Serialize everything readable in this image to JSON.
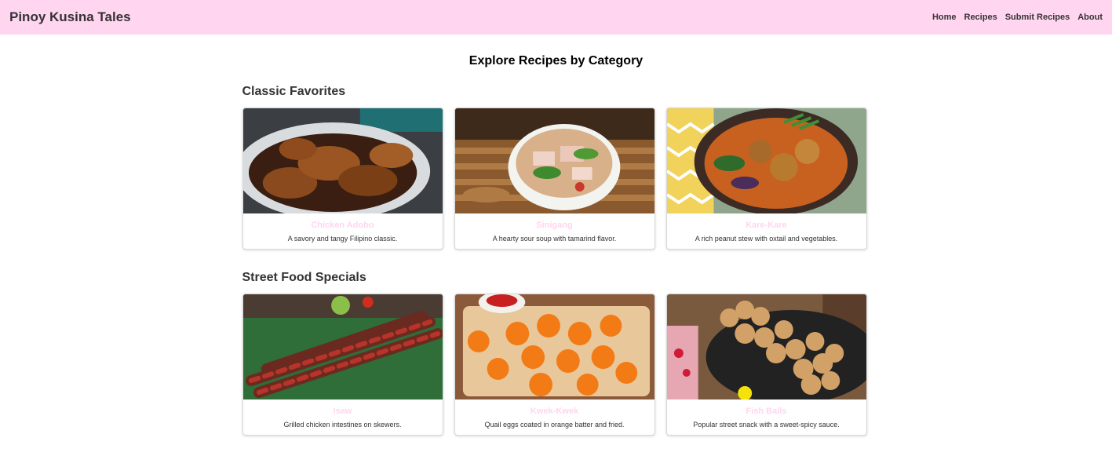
{
  "header": {
    "brand": "Pinoy Kusina Tales",
    "nav": [
      "Home",
      "Recipes",
      "Submit Recipes",
      "About"
    ],
    "background_color": "#ffd5ef"
  },
  "main": {
    "title": "Explore Recipes by Category",
    "sections": [
      {
        "title": "Classic Favorites",
        "cards": [
          {
            "title": "Chicken Adobo",
            "description": "A savory and tangy Filipino classic.",
            "image": "chicken-adobo-photo"
          },
          {
            "title": "Sinigang",
            "description": "A hearty sour soup with tamarind flavor.",
            "image": "sinigang-photo"
          },
          {
            "title": "Kare-Kare",
            "description": "A rich peanut stew with oxtail and vegetables.",
            "image": "kare-kare-photo"
          }
        ]
      },
      {
        "title": "Street Food Specials",
        "cards": [
          {
            "title": "Isaw",
            "description": "Grilled chicken intestines on skewers.",
            "image": "isaw-photo"
          },
          {
            "title": "Kwek-Kwek",
            "description": "Quail eggs coated in orange batter and fried.",
            "image": "kwek-kwek-photo"
          },
          {
            "title": "Fish Balls",
            "description": "Popular street snack with a sweet-spicy sauce.",
            "image": "fish-balls-photo"
          }
        ]
      }
    ]
  },
  "colors": {
    "accent_pink": "#ffd5ef",
    "card_title": "#ffd5ef"
  }
}
